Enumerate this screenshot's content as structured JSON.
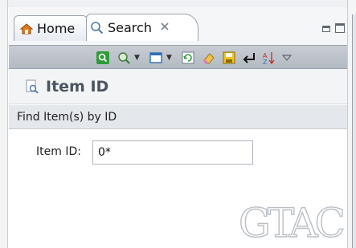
{
  "tabs": {
    "home_label": "Home",
    "search_label": "Search",
    "search_close_icon": "close-icon",
    "home_icon": "home-icon",
    "search_icon": "search-icon"
  },
  "toolbar": {
    "icons": [
      "run-search-icon",
      "search-options-icon",
      "dropdown-arrow-icon",
      "view-menu-icon",
      "dropdown-arrow-icon",
      "refresh-icon",
      "clear-icon",
      "save-icon",
      "execute-icon",
      "sort-icon",
      "view-menu-chevron-icon"
    ]
  },
  "view": {
    "title": "Item ID",
    "section": "Find Item(s) by ID"
  },
  "form": {
    "item_id_label": "Item ID:",
    "item_id_value": "0*"
  },
  "watermark": "GTAC",
  "colors": {
    "toolbar_bg": "#b4bac2",
    "section_bg": "#e4e7eb",
    "title_color": "#4b5562"
  }
}
